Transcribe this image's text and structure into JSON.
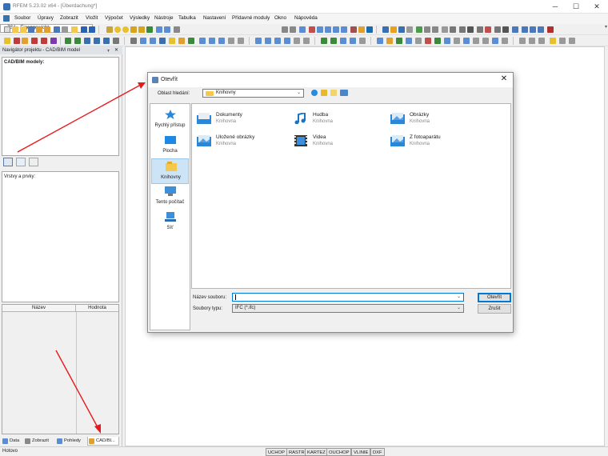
{
  "window": {
    "title": "RFEM 5.23.02 x64 - [Überdachung*]",
    "controls": [
      "─",
      "☐",
      "✕"
    ]
  },
  "menu": [
    {
      "label": "Soubor"
    },
    {
      "label": "Úpravy"
    },
    {
      "label": "Zobrazit"
    },
    {
      "label": "Vložit"
    },
    {
      "label": "Výpočet"
    },
    {
      "label": "Výsledky"
    },
    {
      "label": "Nástroje"
    },
    {
      "label": "Tabulka"
    },
    {
      "label": "Nastavení"
    },
    {
      "label": "Přídavné moduly"
    },
    {
      "label": "Okno"
    },
    {
      "label": "Nápověda"
    }
  ],
  "toolbar": {
    "load_case": "ZS1 - Eigengewicht"
  },
  "navigator": {
    "title": "Navigátor projektu - CAD/BIM model",
    "pin": "ᚁ",
    "close": "✕",
    "cad_models_header": "CAD/BIM modely:",
    "layers_header": "Vrstvy a prvky:",
    "table_col_name": "Název",
    "table_col_value": "Hodnota",
    "tabs": [
      {
        "label": "Data"
      },
      {
        "label": "Zobrazit"
      },
      {
        "label": "Pohledy"
      },
      {
        "label": "CAD/Bl..."
      }
    ]
  },
  "status": {
    "ready": "Hotovo",
    "buttons": [
      "UCHOP",
      "RASTR",
      "KARTEZ",
      "OUCHOP",
      "VLINIE",
      "DXF"
    ]
  },
  "dialog": {
    "title": "Otevřít",
    "close": "✕",
    "look_in_label": "Oblast hledání:",
    "look_in_value": "Knihovny",
    "places": [
      {
        "label": "Rychlý přístup"
      },
      {
        "label": "Plocha"
      },
      {
        "label": "Knihovny"
      },
      {
        "label": "Tento počítač"
      },
      {
        "label": "Síť"
      }
    ],
    "items": [
      {
        "name": "Dokumenty",
        "sub": "Knihovna"
      },
      {
        "name": "Hudba",
        "sub": "Knihovna"
      },
      {
        "name": "Obrázky",
        "sub": "Knihovna"
      },
      {
        "name": "Uložené obrázky",
        "sub": "Knihovna"
      },
      {
        "name": "Videa",
        "sub": "Knihovna"
      },
      {
        "name": "Z fotoaparátu",
        "sub": "Knihovna"
      }
    ],
    "filename_label": "Název souboru:",
    "filename_value": "",
    "filetype_label": "Soubory typu:",
    "filetype_value": "IFC (*.ifc)",
    "open_button": "Otevřít",
    "cancel_button": "Zrušit"
  },
  "colors": {
    "arrow": "#e8191c",
    "selection": "#cde4f7",
    "accent": "#0078d7"
  }
}
